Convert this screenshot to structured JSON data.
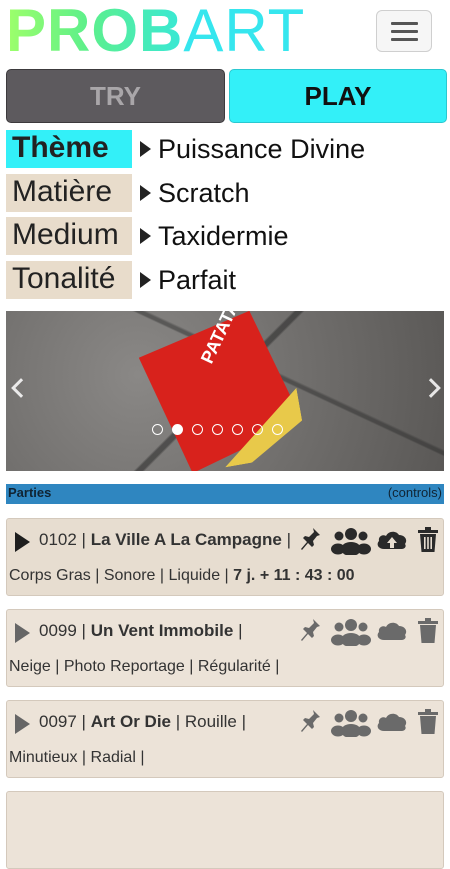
{
  "header": {
    "logo_bold": "PROB",
    "logo_thin": "ART",
    "menu_icon": "hamburger-icon"
  },
  "mode_buttons": {
    "try_label": "TRY",
    "play_label": "PLAY"
  },
  "attributes": [
    {
      "name": "Thème",
      "value": "Puissance Divine",
      "active": true
    },
    {
      "name": "Matière",
      "value": "Scratch",
      "active": false
    },
    {
      "name": "Medium",
      "value": "Taxidermie",
      "active": false
    },
    {
      "name": "Tonalité",
      "value": "Parfait",
      "active": false
    }
  ],
  "carousel": {
    "image_text": "PATATAS FRITAS",
    "slide_count": 7,
    "active_slide": 1,
    "prev_icon": "chevron-left-icon",
    "next_icon": "chevron-right-icon"
  },
  "parties": {
    "title": "Parties",
    "controls_label": "(controls)"
  },
  "games": [
    {
      "id": "0102",
      "title": "La Ville A La Campagne",
      "extra": "|",
      "tags": "Corps Gras | Sonore | Liquide | ",
      "time": "7 j. + 11 : 43 : 00"
    },
    {
      "id": "0099",
      "title": "Un Vent Immobile",
      "extra": "|",
      "tags": "Neige | Photo Reportage | Régularité |",
      "time": ""
    },
    {
      "id": "0097",
      "title": "Art Or Die",
      "extra": "| Rouille |",
      "tags": "Minutieux | Radial |",
      "time": ""
    }
  ],
  "colors": {
    "accent_cyan": "#33f0f8",
    "try_gray": "#5d5a5e",
    "tag_beige": "#e8dccb",
    "parties_blue": "#2f86c0"
  }
}
